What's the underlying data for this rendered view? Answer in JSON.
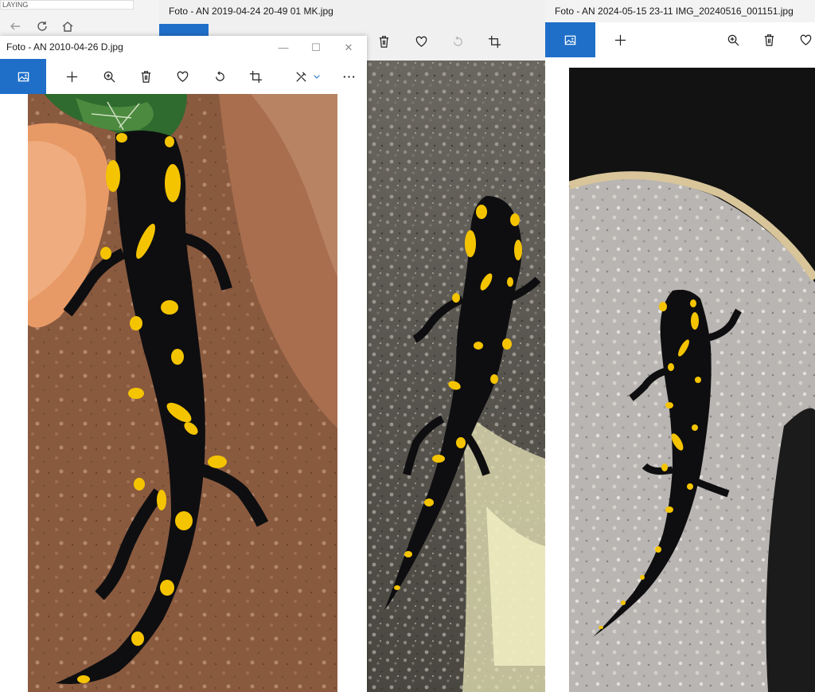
{
  "browser": {
    "tab_text": "LAYING",
    "nav_icons": [
      "back-arrow-icon",
      "reload-icon",
      "home-icon"
    ]
  },
  "windows": [
    {
      "title": "Foto - AN 2010-04-26 D.jpg",
      "toolbar": [
        "view-image-icon",
        "add-icon",
        "zoom-in-icon",
        "delete-icon",
        "favorite-icon",
        "rotate-icon",
        "crop-icon",
        "edit-icon",
        "more-icon"
      ]
    },
    {
      "title": "Foto - AN 2019-04-24 20-49 01 MK.jpg",
      "toolbar": [
        "delete-icon",
        "favorite-icon",
        "rotate-icon",
        "crop-icon"
      ]
    },
    {
      "title": "Foto - AN 2024-05-15 23-11 IMG_20240516_001151.jpg",
      "toolbar": [
        "view-image-icon",
        "add-icon",
        "zoom-in-icon",
        "delete-icon",
        "favorite-icon"
      ]
    }
  ],
  "colors": {
    "accent": "#1f6fc9",
    "salamander_body": "#0e0e10",
    "salamander_spots": "#f5c400"
  }
}
